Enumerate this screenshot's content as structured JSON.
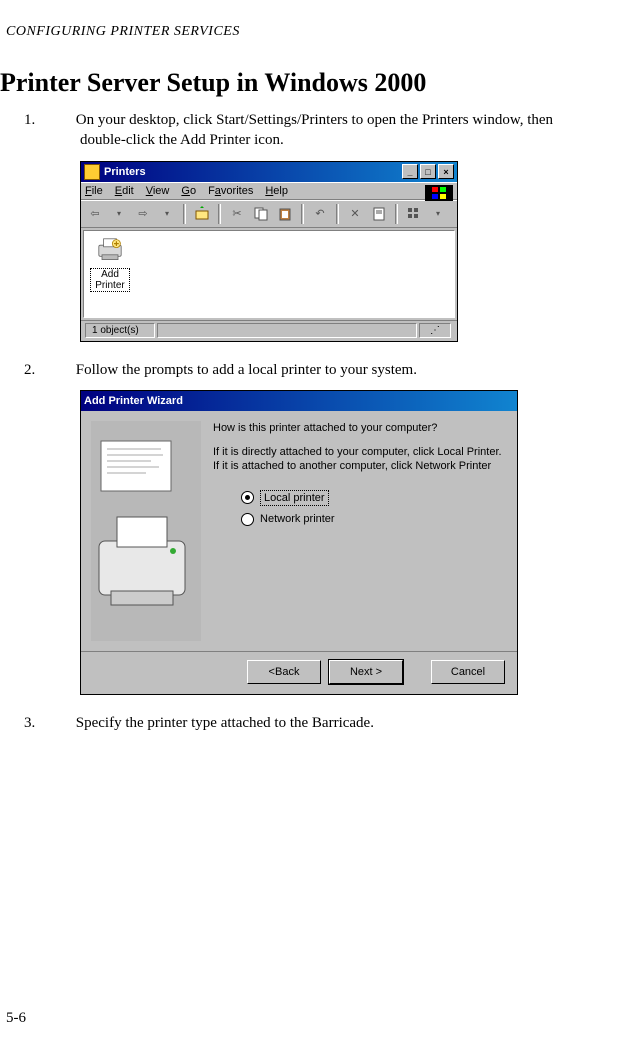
{
  "header": "CONFIGURING PRINTER SERVICES",
  "title": "Printer Server Setup in Windows 2000",
  "steps": {
    "s1_num": "1.",
    "s1_text": "On your desktop, click Start/Settings/Printers to open the Printers window, then double-click the Add Printer icon.",
    "s2_num": "2.",
    "s2_text": "Follow the prompts to add a local printer to your system.",
    "s3_num": "3.",
    "s3_text": "Specify the printer type attached to the Barricade."
  },
  "printers_win": {
    "title": "Printers",
    "menu": {
      "file": "File",
      "edit": "Edit",
      "view": "View",
      "go": "Go",
      "fav": "Favorites",
      "help": "Help"
    },
    "icon_label": "Add Printer",
    "status": "1 object(s)"
  },
  "wizard": {
    "title": "Add Printer Wizard",
    "q": "How is this printer attached to your computer?",
    "desc": "If it is directly attached to your computer, click Local Printer. If it is attached to another computer, click Network Printer",
    "opt_local": "Local printer",
    "opt_network": "Network printer",
    "btn_back": "< Back",
    "btn_next": "Next >",
    "btn_cancel": "Cancel"
  },
  "page_num": "5-6"
}
